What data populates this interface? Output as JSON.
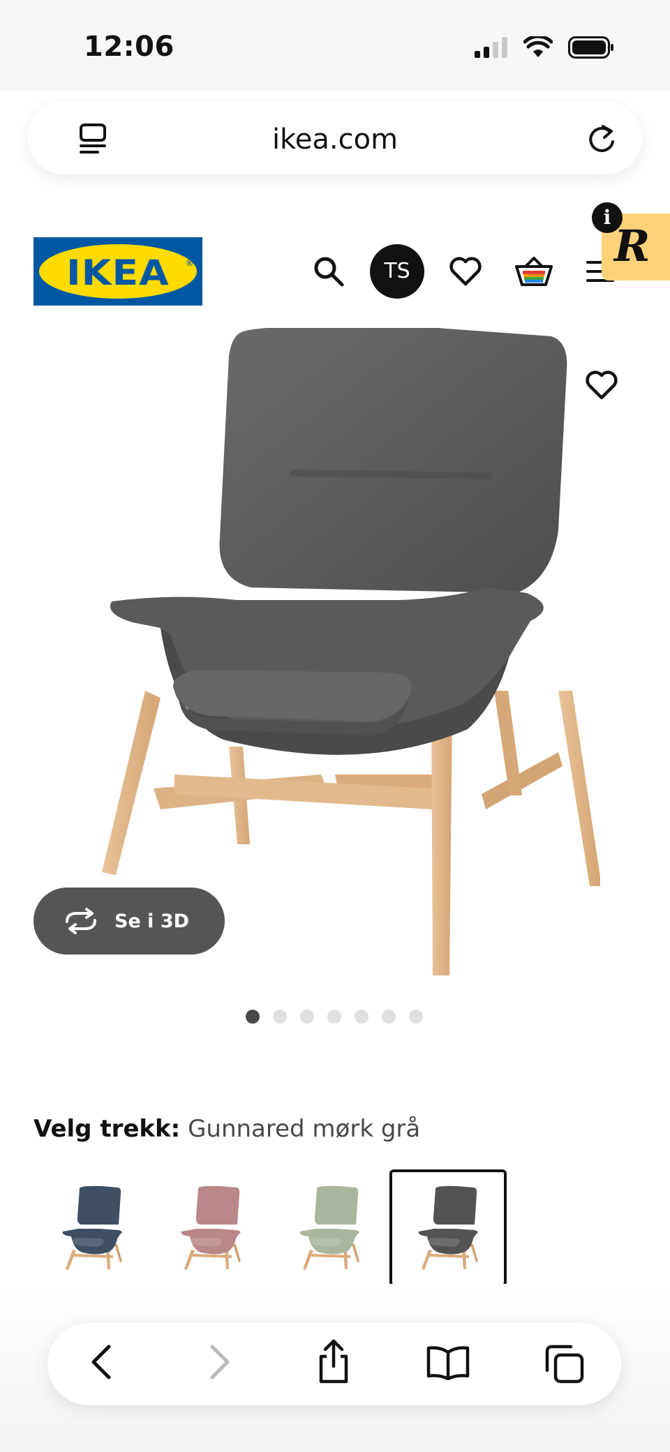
{
  "status_bar": {
    "time": "12:06",
    "icons": [
      "cellular-signal-icon",
      "wifi-icon",
      "battery-icon"
    ]
  },
  "browser": {
    "url": "ikea.com",
    "icons": [
      "reader-mode-icon",
      "reload-icon"
    ]
  },
  "header": {
    "logo_text": "IKEA",
    "logo_colors": {
      "blue": "#0058a3",
      "yellow": "#ffdb00"
    },
    "avatar_initials": "TS",
    "icons": [
      "search-icon",
      "wishlist-heart-icon",
      "shopping-basket-icon",
      "menu-icon"
    ]
  },
  "extension": {
    "info_glyph": "i",
    "badge_letter": "R",
    "badge_color": "#ffd27a"
  },
  "product": {
    "image": "grey-upholstered-high-back-armchair-with-wooden-legs",
    "view_3d_label": "Se i 3D",
    "carousel": {
      "total": 7,
      "active_index": 0
    }
  },
  "variant": {
    "label": "Velg trekk:",
    "selected_value": "Gunnared mørk grå",
    "options": [
      {
        "color": "#3e4f63",
        "selected": false
      },
      {
        "color": "#b98788",
        "selected": false
      },
      {
        "color": "#a9b59d",
        "selected": false
      },
      {
        "color": "#535353",
        "selected": true
      }
    ]
  },
  "toolbar": {
    "icons": [
      "back-icon",
      "forward-icon",
      "share-icon",
      "bookmarks-icon",
      "tabs-icon"
    ],
    "forward_enabled": false
  }
}
